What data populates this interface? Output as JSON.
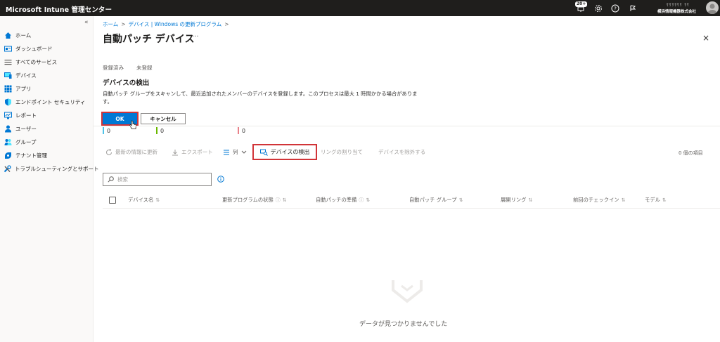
{
  "app": {
    "title": "Microsoft Intune 管理センター",
    "notification_badge": "20+",
    "account_line1": "ｻｻｻｻｻｻ ｻｻ",
    "account_line2": "横浜情報機器株式会社"
  },
  "sidebar": {
    "collapse": "«",
    "items": [
      {
        "label": "ホーム",
        "icon": "home-icon"
      },
      {
        "label": "ダッシュボード",
        "icon": "dashboard-icon"
      },
      {
        "label": "すべてのサービス",
        "icon": "all-services-icon"
      },
      {
        "label": "デバイス",
        "icon": "devices-icon"
      },
      {
        "label": "アプリ",
        "icon": "apps-icon"
      },
      {
        "label": "エンドポイント セキュリティ",
        "icon": "shield-icon"
      },
      {
        "label": "レポート",
        "icon": "reports-icon"
      },
      {
        "label": "ユーザー",
        "icon": "user-icon"
      },
      {
        "label": "グループ",
        "icon": "groups-icon"
      },
      {
        "label": "テナント管理",
        "icon": "tenant-icon"
      },
      {
        "label": "トラブルシューティングとサポート",
        "icon": "tools-icon"
      }
    ]
  },
  "breadcrumb": [
    "ホーム",
    "デバイス | Windows の更新プログラム"
  ],
  "page": {
    "title": "自動パッチ デバイス",
    "more": "···",
    "close": "×"
  },
  "tabs": [
    "登録済み",
    "未登録"
  ],
  "dialog": {
    "title": "デバイスの検出",
    "description": "自動パッチ グループをスキャンして、最近追加されたメンバーのデバイスを登録します。このプロセスは最大 1 時間かかる場合があります。",
    "ok_label": "OK",
    "cancel_label": "キャンセル"
  },
  "stats": [
    {
      "value": "0",
      "color": "#4fc3e8"
    },
    {
      "value": "0",
      "color": "#6bb700"
    },
    {
      "value": "0",
      "color": "#e8828a"
    }
  ],
  "toolbar": {
    "refresh": "最新の情報に更新",
    "export": "エクスポート",
    "columns": "列",
    "detect": "デバイスの検出",
    "assign_ring": "リングの割り当て",
    "remove": "デバイスを除外する",
    "count": "0 個の項目"
  },
  "search": {
    "placeholder": "検索"
  },
  "table": {
    "headers": [
      "デバイス名",
      "更新プログラムの状態",
      "自動パッチの準備",
      "自動パッチ グループ",
      "展開リング",
      "前回のチェックイン",
      "モデル"
    ]
  },
  "empty": {
    "text": "データが見つかりませんでした"
  },
  "colors": {
    "accent": "#0078d4",
    "highlight": "#d13438",
    "topbar": "#1f1e1c"
  }
}
